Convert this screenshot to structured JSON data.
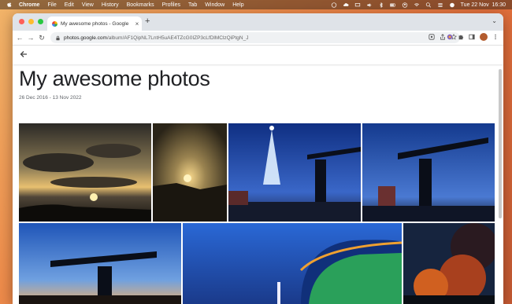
{
  "menubar": {
    "app_name": "Chrome",
    "items": [
      "File",
      "Edit",
      "View",
      "History",
      "Bookmarks",
      "Profiles",
      "Tab",
      "Window",
      "Help"
    ],
    "clock": "Tue 22 Nov  16:30"
  },
  "browser": {
    "tab_title": "My awesome photos - Google",
    "url_domain": "photos.google.com",
    "url_path": "/album/AF1QipNL7LntH5uAE4TZcG0IZP3cLfDlMClzQiPtgN_J"
  },
  "album": {
    "title": "My awesome photos",
    "dates": "26 Dec 2016 - 13 Nov 2022"
  },
  "colors": {
    "traffic_close": "#ff5f57",
    "traffic_min": "#febc2e",
    "traffic_max": "#28c840"
  },
  "photos": [
    {
      "name": "photo-sunset-clouds",
      "subject": "sunset over water with dark clouds"
    },
    {
      "name": "photo-rainy-sunset",
      "subject": "sunset through rainy window"
    },
    {
      "name": "photo-crane-christmas-tree",
      "subject": "crane and illuminated tree at dusk"
    },
    {
      "name": "photo-crane-dusk",
      "subject": "crane at dusk with lights"
    },
    {
      "name": "photo-crane-sunset",
      "subject": "crane silhouette at sunset"
    },
    {
      "name": "photo-arena-lights",
      "subject": "illuminated arena building with green lights"
    },
    {
      "name": "photo-autumn-night",
      "subject": "autumn tree lit at night"
    }
  ]
}
